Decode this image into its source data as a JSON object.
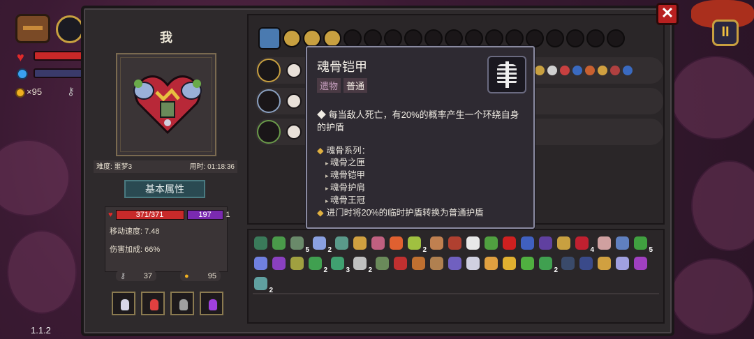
{
  "hud": {
    "coins": "×95",
    "version": "1.1.2"
  },
  "panel": {
    "close_label": "✕",
    "pause_label": "II"
  },
  "character": {
    "name": "我",
    "difficulty": "难度: 噩梦3",
    "time": "用时: 01:18:36",
    "attr_title": "基本属性",
    "hp": "371/371",
    "shield": "197",
    "shield_extra": "1",
    "move_speed": "移动速度: 7.48",
    "damage_bonus": "伤害加成: 66%",
    "keys": "37",
    "gold": "95"
  },
  "potions": [
    {
      "color": "#d8d8e8"
    },
    {
      "color": "#e04040"
    },
    {
      "color": "#a0a0a0"
    },
    {
      "color": "#a040e0"
    }
  ],
  "tooltip": {
    "name": "魂骨铠甲",
    "tag_type": "遗物",
    "tag_rarity": "普通",
    "icon": "soul-bone-armor-icon",
    "description": "每当敌人死亡，有20%的概率产生一个环绕自身的护盾",
    "series_title": "魂骨系列：",
    "series": [
      "魂骨之匣",
      "魂骨铠甲",
      "魂骨护肩",
      "魂骨王冠"
    ],
    "set_bonus": "进门时将20%的临时护盾转换为普通护盾"
  },
  "relics": [
    {
      "c": "#3a7a5a",
      "n": ""
    },
    {
      "c": "#4a9a4a",
      "n": ""
    },
    {
      "c": "#6a8a6a",
      "n": "5"
    },
    {
      "c": "#8aa0e0",
      "n": "2"
    },
    {
      "c": "#5a9a8a",
      "n": ""
    },
    {
      "c": "#d0a040",
      "n": ""
    },
    {
      "c": "#c06080",
      "n": ""
    },
    {
      "c": "#e06030",
      "n": ""
    },
    {
      "c": "#a0c040",
      "n": "2"
    },
    {
      "c": "#c08050",
      "n": ""
    },
    {
      "c": "#b04030",
      "n": ""
    },
    {
      "c": "#e8e8e8",
      "n": ""
    },
    {
      "c": "#50a040",
      "n": ""
    },
    {
      "c": "#d02020",
      "n": ""
    },
    {
      "c": "#4060c0",
      "n": ""
    },
    {
      "c": "#6040a0",
      "n": ""
    },
    {
      "c": "#c8a040",
      "n": ""
    },
    {
      "c": "#c02030",
      "n": "4"
    },
    {
      "c": "#d0a0a0",
      "n": ""
    },
    {
      "c": "#6080c0",
      "n": ""
    },
    {
      "c": "#40a040",
      "n": "5"
    },
    {
      "c": "#7080e0",
      "n": ""
    },
    {
      "c": "#8a40c0",
      "n": ""
    },
    {
      "c": "#a0a040",
      "n": ""
    },
    {
      "c": "#40a050",
      "n": "2"
    },
    {
      "c": "#40a070",
      "n": "3"
    },
    {
      "c": "#c0c0c0",
      "n": "2"
    },
    {
      "c": "#6a8a5a",
      "n": ""
    },
    {
      "c": "#c03030",
      "n": ""
    },
    {
      "c": "#c07030",
      "n": ""
    },
    {
      "c": "#b08050",
      "n": ""
    },
    {
      "c": "#7060c0",
      "n": ""
    },
    {
      "c": "#d0d0e0",
      "n": ""
    },
    {
      "c": "#e0a040",
      "n": ""
    },
    {
      "c": "#e0b030",
      "n": ""
    },
    {
      "c": "#50b040",
      "n": ""
    },
    {
      "c": "#40a050",
      "n": "2"
    },
    {
      "c": "#3a4a6a",
      "n": ""
    },
    {
      "c": "#3a4a8a",
      "n": ""
    },
    {
      "c": "#d0a040",
      "n": ""
    },
    {
      "c": "#a0a0e0",
      "n": ""
    },
    {
      "c": "#a040c0",
      "n": ""
    },
    {
      "c": "#60a0a0",
      "n": "2"
    }
  ],
  "wand_rows": [
    {
      "spells": 1,
      "minis": [
        "#c8a040",
        "#c84040",
        "#3a6ac0",
        "#d0d040"
      ]
    },
    {
      "spells": 1,
      "minis": []
    },
    {
      "spells": 1,
      "minis": []
    }
  ]
}
